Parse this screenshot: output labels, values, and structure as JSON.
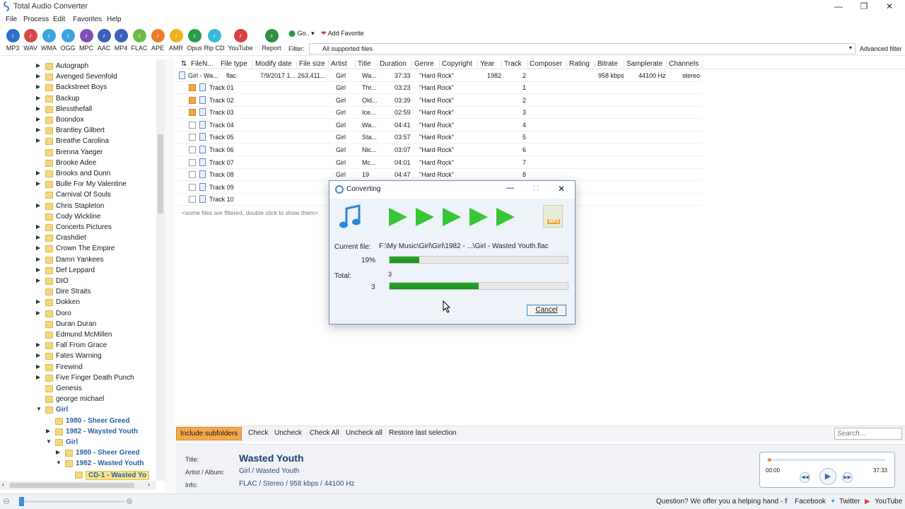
{
  "app": {
    "title": "Total Audio Converter"
  },
  "menu": [
    "File",
    "Process",
    "Edit",
    "Favorites",
    "Help"
  ],
  "toolbar": {
    "buttons": [
      {
        "label": "MP3",
        "color": "#2e6fcf"
      },
      {
        "label": "WAV",
        "color": "#d64848"
      },
      {
        "label": "WMA",
        "color": "#3aa3e0"
      },
      {
        "label": "OGG",
        "color": "#3aa3e0"
      },
      {
        "label": "MPC",
        "color": "#7b4fb3"
      },
      {
        "label": "AAC",
        "color": "#3d5fb8"
      },
      {
        "label": "MP4",
        "color": "#3d5fb8"
      },
      {
        "label": "FLAC",
        "color": "#6cbc44"
      },
      {
        "label": "APE",
        "color": "#f07b2e"
      },
      {
        "label": "AMR",
        "color": "#f0b020"
      },
      {
        "label": "Opus",
        "color": "#2a9a4a"
      },
      {
        "label": "Rip CD",
        "color": "#3ab8d8"
      },
      {
        "label": "YouTube",
        "color": "#d94141"
      },
      {
        "label": "Report",
        "color": "#2f8f3f"
      }
    ],
    "go": "Go..",
    "add_favorite": "Add Favorite",
    "filter_label": "Filter:",
    "filter_value": "All supported files",
    "advanced_filter": "Advanced filter"
  },
  "tree": {
    "items": [
      {
        "label": "Autograph",
        "arrow": "▶"
      },
      {
        "label": "Avenged Sevenfold",
        "arrow": "▶"
      },
      {
        "label": "Backstreet Boys",
        "arrow": "▶"
      },
      {
        "label": "Backup",
        "arrow": "▶"
      },
      {
        "label": "Blessthefall",
        "arrow": "▶"
      },
      {
        "label": "Boondox",
        "arrow": "▶"
      },
      {
        "label": "Brantley Gilbert",
        "arrow": "▶"
      },
      {
        "label": "Breathe Carolina",
        "arrow": "▶"
      },
      {
        "label": "Brenna Yaeger",
        "arrow": ""
      },
      {
        "label": "Brooke Adee",
        "arrow": ""
      },
      {
        "label": "Brooks and Dunn",
        "arrow": "▶"
      },
      {
        "label": "Bulle For My Valentine",
        "arrow": "▶"
      },
      {
        "label": "Carnival Of Souls",
        "arrow": ""
      },
      {
        "label": "Chris Stapleton",
        "arrow": "▶"
      },
      {
        "label": "Cody Wickline",
        "arrow": ""
      },
      {
        "label": "Concerts Pictures",
        "arrow": "▶"
      },
      {
        "label": "Crashdiet",
        "arrow": "▶"
      },
      {
        "label": "Crown The Empire",
        "arrow": "▶"
      },
      {
        "label": "Damn Yankees",
        "arrow": "▶"
      },
      {
        "label": "Def Leppard",
        "arrow": "▶"
      },
      {
        "label": "DIO",
        "arrow": "▶"
      },
      {
        "label": "Dire Straits",
        "arrow": ""
      },
      {
        "label": "Dokken",
        "arrow": "▶"
      },
      {
        "label": "Doro",
        "arrow": "▶"
      },
      {
        "label": "Duran Duran",
        "arrow": ""
      },
      {
        "label": "Edmund McMillen",
        "arrow": ""
      },
      {
        "label": "Fall From Grace",
        "arrow": "▶"
      },
      {
        "label": "Fates Warning",
        "arrow": "▶"
      },
      {
        "label": "Firewind",
        "arrow": "▶"
      },
      {
        "label": "Five Finger Death Punch",
        "arrow": "▶"
      },
      {
        "label": "Genesis",
        "arrow": ""
      },
      {
        "label": "george michael",
        "arrow": ""
      },
      {
        "label": "Girl",
        "arrow": "▼",
        "style": "blue",
        "indent": 0
      },
      {
        "label": "1980 - Sheer Greed",
        "arrow": "",
        "style": "blue",
        "indent": 1
      },
      {
        "label": "1982 - Waysted Youth",
        "arrow": "▶",
        "style": "blue",
        "indent": 1
      },
      {
        "label": "Girl",
        "arrow": "▼",
        "style": "blue",
        "indent": 1
      },
      {
        "label": "1980 - Sheer Greed",
        "arrow": "▶",
        "style": "blue",
        "indent": 2
      },
      {
        "label": "1982 - Wasted Youth",
        "arrow": "▼",
        "style": "blue",
        "indent": 2
      },
      {
        "label": "CD-1 - Wasted Yo",
        "arrow": "",
        "style": "sel",
        "indent": 3
      }
    ]
  },
  "grid": {
    "columns": [
      "FileN...",
      "File type",
      "Modify date",
      "File size",
      "Artist",
      "Title",
      "Duration",
      "Genre",
      "Copyright",
      "Year",
      "Track",
      "Composer",
      "Rating",
      "Bitrate",
      "Samplerate",
      "Channels"
    ],
    "main_row": {
      "name": "Girl - Wa...",
      "type": "flac",
      "date": "7/9/2017 1...",
      "size": "263,411...",
      "artist": "Girl",
      "title": "Wa...",
      "duration": "37:33",
      "genre": "\"Hard Rock\"",
      "year": "1982",
      "track": "2",
      "bitrate": "958 kbps",
      "samplerate": "44100 Hz",
      "channels": "stereo"
    },
    "rows": [
      {
        "name": "Track 01",
        "checked": true,
        "artist": "Girl",
        "title": "Thr...",
        "duration": "03:23",
        "genre": "\"Hard Rock\"",
        "track": "1"
      },
      {
        "name": "Track 02",
        "checked": true,
        "artist": "Girl",
        "title": "Old...",
        "duration": "03:39",
        "genre": "\"Hard Rock\"",
        "track": "2"
      },
      {
        "name": "Track 03",
        "checked": true,
        "artist": "Girl",
        "title": "Ice...",
        "duration": "02:59",
        "genre": "\"Hard Rock\"",
        "track": "3"
      },
      {
        "name": "Track 04",
        "checked": false,
        "artist": "Girl",
        "title": "Wa...",
        "duration": "04:41",
        "genre": "\"Hard Rock\"",
        "track": "4"
      },
      {
        "name": "Track 05",
        "checked": false,
        "artist": "Girl",
        "title": "Sta...",
        "duration": "03:57",
        "genre": "\"Hard Rock\"",
        "track": "5"
      },
      {
        "name": "Track 06",
        "checked": false,
        "artist": "Girl",
        "title": "Nic...",
        "duration": "03:07",
        "genre": "\"Hard Rock\"",
        "track": "6"
      },
      {
        "name": "Track 07",
        "checked": false,
        "artist": "Girl",
        "title": "Mc...",
        "duration": "04:01",
        "genre": "\"Hard Rock\"",
        "track": "7"
      },
      {
        "name": "Track 08",
        "checked": false,
        "artist": "Girl",
        "title": "19",
        "duration": "04:47",
        "genre": "\"Hard Rock\"",
        "track": "8"
      },
      {
        "name": "Track 09",
        "checked": false,
        "artist": "",
        "title": "",
        "duration": "",
        "genre": "",
        "track": ""
      },
      {
        "name": "Track 10",
        "checked": false,
        "artist": "",
        "title": "",
        "duration": "",
        "genre": "",
        "track": ""
      }
    ],
    "filtered_note": "<some files are filtered, double click to show them>"
  },
  "actions": {
    "include_subfolders": "Include subfolders",
    "check": "Check",
    "uncheck": "Uncheck",
    "check_all": "Check All",
    "uncheck_all": "Uncheck all",
    "restore": "Restore last selection",
    "search_placeholder": "Search..."
  },
  "info": {
    "title_label": "Title:",
    "title_value": "Wasted Youth",
    "artist_label": "Artist / Album:",
    "artist_value": "Girl / Wasted Youth",
    "info_label": "Info:",
    "info_value": "FLAC / Stereo / 958 kbps / 44100 Hz"
  },
  "player": {
    "current": "00:00",
    "total": "37:33"
  },
  "status": {
    "question": "Question? We offer you a helping hand -",
    "facebook": "Facebook",
    "twitter": "Twitter",
    "youtube": "YouTube"
  },
  "dialog": {
    "title": "Converting",
    "current_file_label": "Current file:",
    "current_file_value": "F:\\My Music\\Girl\\Girl\\1982 - ...\\Girl - Wasted Youth.flac",
    "file_percent_label": "19%",
    "file_progress": 0.165,
    "total_label": "Total:",
    "total_top": "3",
    "total_count": "3",
    "total_progress": 0.5,
    "cancel": "Cancel",
    "target_format": "MP3"
  }
}
